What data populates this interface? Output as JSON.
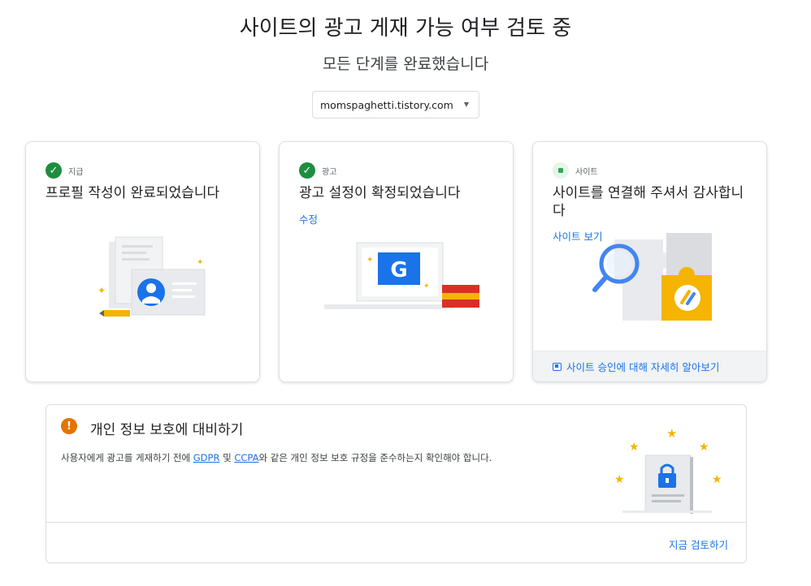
{
  "header": {
    "title": "사이트의 광고 게재 가능 여부 검토 중",
    "subtitle": "모든 단계를 완료했습니다"
  },
  "site_selector": {
    "value": "momspaghetti.tistory.com"
  },
  "cards": [
    {
      "step_label": "지급",
      "status": "complete",
      "title": "프로필 작성이 완료되었습니다"
    },
    {
      "step_label": "광고",
      "status": "complete",
      "title": "광고 설정이 확정되었습니다",
      "link": "수정"
    },
    {
      "step_label": "사이트",
      "status": "pending",
      "title": "사이트를 연결해 주셔서 감사합니다",
      "link": "사이트 보기",
      "footer_link": "사이트 승인에 대해 자세히 알아보기"
    }
  ],
  "privacy": {
    "title": "개인 정보 보호에 대비하기",
    "desc_before": "사용자에게 광고를 게재하기 전에 ",
    "gdpr": "GDPR",
    "and": " 및 ",
    "ccpa": "CCPA",
    "desc_after": "와 같은 개인 정보 보호 규정을 준수하는지 확인해야 합니다.",
    "action": "지금 검토하기"
  },
  "colors": {
    "accent": "#1a73e8",
    "success": "#1e8e3e",
    "warning": "#e37400",
    "star": "#f4b400"
  }
}
